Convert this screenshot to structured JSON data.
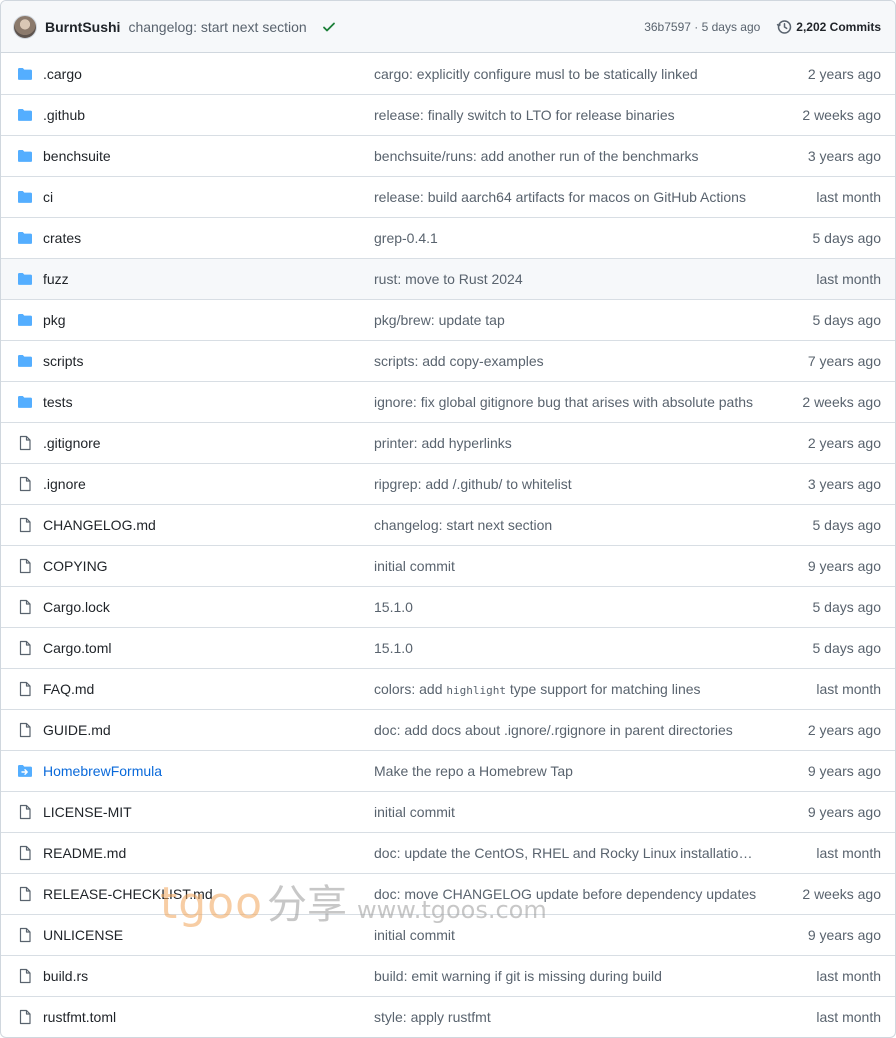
{
  "commit": {
    "author": "BurntSushi",
    "message": "changelog: start next section",
    "sha_age": "36b7597 · 5 days ago",
    "commits_label": "2,202 Commits",
    "status": "success"
  },
  "files": [
    {
      "type": "folder",
      "name": ".cargo",
      "message": "cargo: explicitly configure musl to be statically linked",
      "age": "2 years ago"
    },
    {
      "type": "folder",
      "name": ".github",
      "message": "release: finally switch to LTO for release binaries",
      "age": "2 weeks ago"
    },
    {
      "type": "folder",
      "name": "benchsuite",
      "message": "benchsuite/runs: add another run of the benchmarks",
      "age": "3 years ago"
    },
    {
      "type": "folder",
      "name": "ci",
      "message": "release: build aarch64 artifacts for macos on GitHub Actions",
      "age": "last month"
    },
    {
      "type": "folder",
      "name": "crates",
      "message": "grep-0.4.1",
      "age": "5 days ago"
    },
    {
      "type": "folder",
      "name": "fuzz",
      "message": "rust: move to Rust 2024",
      "age": "last month",
      "hover": true
    },
    {
      "type": "folder",
      "name": "pkg",
      "message": "pkg/brew: update tap",
      "age": "5 days ago"
    },
    {
      "type": "folder",
      "name": "scripts",
      "message": "scripts: add copy-examples",
      "age": "7 years ago"
    },
    {
      "type": "folder",
      "name": "tests",
      "message": "ignore: fix global gitignore bug that arises with absolute paths",
      "age": "2 weeks ago"
    },
    {
      "type": "file",
      "name": ".gitignore",
      "message": "printer: add hyperlinks",
      "age": "2 years ago"
    },
    {
      "type": "file",
      "name": ".ignore",
      "message": "ripgrep: add /.github/ to whitelist",
      "age": "3 years ago"
    },
    {
      "type": "file",
      "name": "CHANGELOG.md",
      "message": "changelog: start next section",
      "age": "5 days ago"
    },
    {
      "type": "file",
      "name": "COPYING",
      "message": "initial commit",
      "age": "9 years ago"
    },
    {
      "type": "file",
      "name": "Cargo.lock",
      "message": "15.1.0",
      "age": "5 days ago"
    },
    {
      "type": "file",
      "name": "Cargo.toml",
      "message": "15.1.0",
      "age": "5 days ago"
    },
    {
      "type": "file",
      "name": "FAQ.md",
      "message_pre": "colors: add ",
      "message_code": "highlight",
      "message_post": " type support for matching lines",
      "age": "last month"
    },
    {
      "type": "file",
      "name": "GUIDE.md",
      "message": "doc: add docs about .ignore/.rgignore in parent directories",
      "age": "2 years ago"
    },
    {
      "type": "submodule",
      "name": "HomebrewFormula",
      "message": "Make the repo a Homebrew Tap",
      "age": "9 years ago"
    },
    {
      "type": "file",
      "name": "LICENSE-MIT",
      "message": "initial commit",
      "age": "9 years ago"
    },
    {
      "type": "file",
      "name": "README.md",
      "message": "doc: update the CentOS, RHEL and Rocky Linux installation instructions",
      "age": "last month"
    },
    {
      "type": "file",
      "name": "RELEASE-CHECKLIST.md",
      "message": "doc: move CHANGELOG update before dependency updates",
      "age": "2 weeks ago"
    },
    {
      "type": "file",
      "name": "UNLICENSE",
      "message": "initial commit",
      "age": "9 years ago"
    },
    {
      "type": "file",
      "name": "build.rs",
      "message": "build: emit warning if git is missing during build",
      "age": "last month"
    },
    {
      "type": "file",
      "name": "rustfmt.toml",
      "message": "style: apply rustfmt",
      "age": "last month"
    }
  ],
  "watermark": {
    "brand": "tgoo",
    "cn": "分享",
    "url": "www.tgoos.com"
  },
  "colors": {
    "folder": "#54aeff",
    "link": "#0969da",
    "success": "#1a7f37"
  }
}
